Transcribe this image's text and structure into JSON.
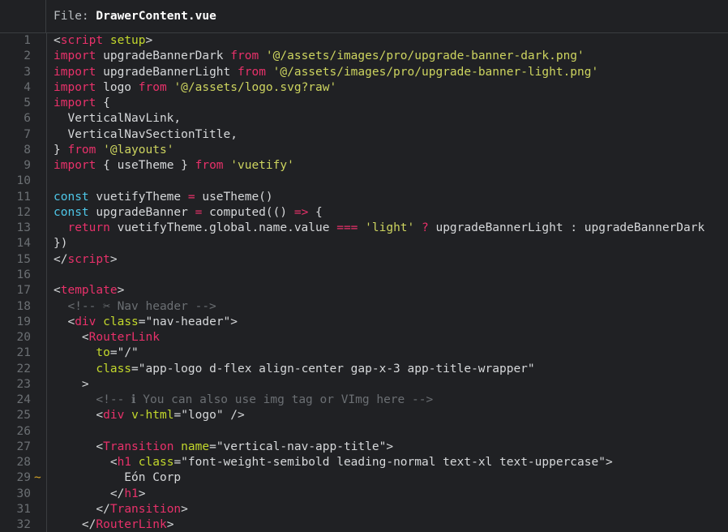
{
  "header": {
    "label": "File: ",
    "filename": "DrawerContent.vue"
  },
  "editor": {
    "background": "#202124",
    "gutter_color": "#6b6f73",
    "marker_color": "#d6a628",
    "colors": {
      "tag": "#e8316a",
      "keyword": "#e8316a",
      "const": "#4ec7e8",
      "attribute": "#c3d82c",
      "string": "#cdd45f",
      "plain": "#d6d8da",
      "comment": "#6b6f73"
    },
    "first_line": 1,
    "last_line": 32,
    "lines": [
      {
        "n": "1",
        "marker": "",
        "tokens": [
          {
            "t": "punct",
            "s": "<"
          },
          {
            "t": "tag",
            "s": "script"
          },
          {
            "t": "plain",
            "s": " "
          },
          {
            "t": "attr",
            "s": "setup"
          },
          {
            "t": "punct",
            "s": ">"
          }
        ]
      },
      {
        "n": "2",
        "marker": "",
        "tokens": [
          {
            "t": "kw",
            "s": "import"
          },
          {
            "t": "plain",
            "s": " upgradeBannerDark "
          },
          {
            "t": "kw",
            "s": "from"
          },
          {
            "t": "plain",
            "s": " "
          },
          {
            "t": "str",
            "s": "'@/assets/images/pro/upgrade-banner-dark.png'"
          }
        ]
      },
      {
        "n": "3",
        "marker": "",
        "tokens": [
          {
            "t": "kw",
            "s": "import"
          },
          {
            "t": "plain",
            "s": " upgradeBannerLight "
          },
          {
            "t": "kw",
            "s": "from"
          },
          {
            "t": "plain",
            "s": " "
          },
          {
            "t": "str",
            "s": "'@/assets/images/pro/upgrade-banner-light.png'"
          }
        ]
      },
      {
        "n": "4",
        "marker": "",
        "tokens": [
          {
            "t": "kw",
            "s": "import"
          },
          {
            "t": "plain",
            "s": " logo "
          },
          {
            "t": "kw",
            "s": "from"
          },
          {
            "t": "plain",
            "s": " "
          },
          {
            "t": "str",
            "s": "'@/assets/logo.svg?raw'"
          }
        ]
      },
      {
        "n": "5",
        "marker": "",
        "tokens": [
          {
            "t": "kw",
            "s": "import"
          },
          {
            "t": "plain",
            "s": " {"
          }
        ]
      },
      {
        "n": "6",
        "marker": "",
        "tokens": [
          {
            "t": "plain",
            "s": "  VerticalNavLink,"
          }
        ]
      },
      {
        "n": "7",
        "marker": "",
        "tokens": [
          {
            "t": "plain",
            "s": "  VerticalNavSectionTitle,"
          }
        ]
      },
      {
        "n": "8",
        "marker": "",
        "tokens": [
          {
            "t": "plain",
            "s": "} "
          },
          {
            "t": "kw",
            "s": "from"
          },
          {
            "t": "plain",
            "s": " "
          },
          {
            "t": "str",
            "s": "'@layouts'"
          }
        ]
      },
      {
        "n": "9",
        "marker": "",
        "tokens": [
          {
            "t": "kw",
            "s": "import"
          },
          {
            "t": "plain",
            "s": " { useTheme } "
          },
          {
            "t": "kw",
            "s": "from"
          },
          {
            "t": "plain",
            "s": " "
          },
          {
            "t": "str",
            "s": "'vuetify'"
          }
        ]
      },
      {
        "n": "10",
        "marker": "",
        "tokens": []
      },
      {
        "n": "11",
        "marker": "",
        "tokens": [
          {
            "t": "const",
            "s": "const"
          },
          {
            "t": "plain",
            "s": " vuetifyTheme "
          },
          {
            "t": "op",
            "s": "="
          },
          {
            "t": "plain",
            "s": " useTheme()"
          }
        ]
      },
      {
        "n": "12",
        "marker": "",
        "tokens": [
          {
            "t": "const",
            "s": "const"
          },
          {
            "t": "plain",
            "s": " upgradeBanner "
          },
          {
            "t": "op",
            "s": "="
          },
          {
            "t": "plain",
            "s": " computed(() "
          },
          {
            "t": "op",
            "s": "=>"
          },
          {
            "t": "plain",
            "s": " {"
          }
        ]
      },
      {
        "n": "13",
        "marker": "",
        "tokens": [
          {
            "t": "plain",
            "s": "  "
          },
          {
            "t": "kw",
            "s": "return"
          },
          {
            "t": "plain",
            "s": " vuetifyTheme.global.name.value "
          },
          {
            "t": "op",
            "s": "==="
          },
          {
            "t": "plain",
            "s": " "
          },
          {
            "t": "str",
            "s": "'light'"
          },
          {
            "t": "plain",
            "s": " "
          },
          {
            "t": "op",
            "s": "?"
          },
          {
            "t": "plain",
            "s": " upgradeBannerLight : upgradeBannerDark"
          }
        ]
      },
      {
        "n": "14",
        "marker": "",
        "tokens": [
          {
            "t": "plain",
            "s": "})"
          }
        ]
      },
      {
        "n": "15",
        "marker": "",
        "tokens": [
          {
            "t": "punct",
            "s": "</"
          },
          {
            "t": "tag",
            "s": "script"
          },
          {
            "t": "punct",
            "s": ">"
          }
        ]
      },
      {
        "n": "16",
        "marker": "",
        "tokens": []
      },
      {
        "n": "17",
        "marker": "",
        "tokens": [
          {
            "t": "punct",
            "s": "<"
          },
          {
            "t": "tag",
            "s": "template"
          },
          {
            "t": "punct",
            "s": ">"
          }
        ]
      },
      {
        "n": "18",
        "marker": "",
        "tokens": [
          {
            "t": "comment",
            "s": "  <!-- ✂ Nav header -->"
          }
        ]
      },
      {
        "n": "19",
        "marker": "",
        "tokens": [
          {
            "t": "plain",
            "s": "  "
          },
          {
            "t": "punct",
            "s": "<"
          },
          {
            "t": "tag",
            "s": "div"
          },
          {
            "t": "plain",
            "s": " "
          },
          {
            "t": "attr",
            "s": "class"
          },
          {
            "t": "punct",
            "s": "="
          },
          {
            "t": "plain",
            "s": "\"nav-header\""
          },
          {
            "t": "punct",
            "s": ">"
          }
        ]
      },
      {
        "n": "20",
        "marker": "",
        "tokens": [
          {
            "t": "plain",
            "s": "    "
          },
          {
            "t": "punct",
            "s": "<"
          },
          {
            "t": "tag",
            "s": "RouterLink"
          }
        ]
      },
      {
        "n": "21",
        "marker": "",
        "tokens": [
          {
            "t": "plain",
            "s": "      "
          },
          {
            "t": "attr",
            "s": "to"
          },
          {
            "t": "punct",
            "s": "="
          },
          {
            "t": "plain",
            "s": "\"/\""
          }
        ]
      },
      {
        "n": "22",
        "marker": "",
        "tokens": [
          {
            "t": "plain",
            "s": "      "
          },
          {
            "t": "attr",
            "s": "class"
          },
          {
            "t": "punct",
            "s": "="
          },
          {
            "t": "plain",
            "s": "\"app-logo d-flex align-center gap-x-3 app-title-wrapper\""
          }
        ]
      },
      {
        "n": "23",
        "marker": "",
        "tokens": [
          {
            "t": "plain",
            "s": "    "
          },
          {
            "t": "punct",
            "s": ">"
          }
        ]
      },
      {
        "n": "24",
        "marker": "",
        "tokens": [
          {
            "t": "comment",
            "s": "      <!-- ℹ You can also use img tag or VImg here -->"
          }
        ]
      },
      {
        "n": "25",
        "marker": "",
        "tokens": [
          {
            "t": "plain",
            "s": "      "
          },
          {
            "t": "punct",
            "s": "<"
          },
          {
            "t": "tag",
            "s": "div"
          },
          {
            "t": "plain",
            "s": " "
          },
          {
            "t": "attr",
            "s": "v-html"
          },
          {
            "t": "punct",
            "s": "="
          },
          {
            "t": "plain",
            "s": "\"logo\" />"
          }
        ]
      },
      {
        "n": "26",
        "marker": "",
        "tokens": []
      },
      {
        "n": "27",
        "marker": "",
        "tokens": [
          {
            "t": "plain",
            "s": "      "
          },
          {
            "t": "punct",
            "s": "<"
          },
          {
            "t": "tag",
            "s": "Transition"
          },
          {
            "t": "plain",
            "s": " "
          },
          {
            "t": "attr",
            "s": "name"
          },
          {
            "t": "punct",
            "s": "="
          },
          {
            "t": "plain",
            "s": "\"vertical-nav-app-title\""
          },
          {
            "t": "punct",
            "s": ">"
          }
        ]
      },
      {
        "n": "28",
        "marker": "",
        "tokens": [
          {
            "t": "plain",
            "s": "        "
          },
          {
            "t": "punct",
            "s": "<"
          },
          {
            "t": "tag",
            "s": "h1"
          },
          {
            "t": "plain",
            "s": " "
          },
          {
            "t": "attr",
            "s": "class"
          },
          {
            "t": "punct",
            "s": "="
          },
          {
            "t": "plain",
            "s": "\"font-weight-semibold leading-normal text-xl text-uppercase\""
          },
          {
            "t": "punct",
            "s": ">"
          }
        ]
      },
      {
        "n": "29",
        "marker": "~",
        "tokens": [
          {
            "t": "plain",
            "s": "          Eón Corp"
          }
        ]
      },
      {
        "n": "30",
        "marker": "",
        "tokens": [
          {
            "t": "plain",
            "s": "        "
          },
          {
            "t": "punct",
            "s": "</"
          },
          {
            "t": "tag",
            "s": "h1"
          },
          {
            "t": "punct",
            "s": ">"
          }
        ]
      },
      {
        "n": "31",
        "marker": "",
        "tokens": [
          {
            "t": "plain",
            "s": "      "
          },
          {
            "t": "punct",
            "s": "</"
          },
          {
            "t": "tag",
            "s": "Transition"
          },
          {
            "t": "punct",
            "s": ">"
          }
        ]
      },
      {
        "n": "32",
        "marker": "",
        "tokens": [
          {
            "t": "plain",
            "s": "    "
          },
          {
            "t": "punct",
            "s": "</"
          },
          {
            "t": "tag",
            "s": "RouterLink"
          },
          {
            "t": "punct",
            "s": ">"
          }
        ]
      }
    ]
  }
}
